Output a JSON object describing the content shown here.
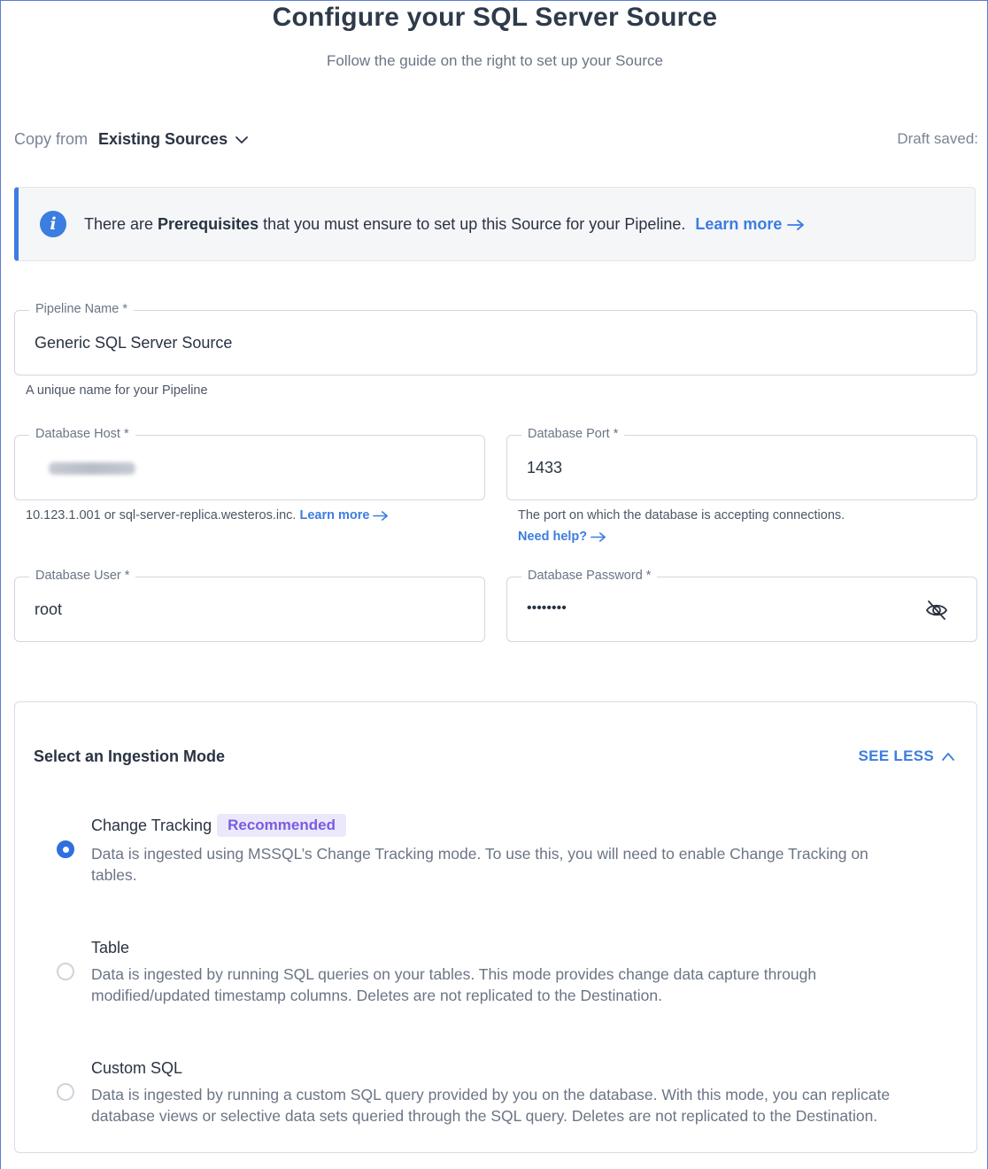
{
  "header": {
    "title": "Configure your SQL Server Source",
    "subtitle": "Follow the guide on the right to set up your Source"
  },
  "copy_from": {
    "label": "Copy from",
    "value": "Existing Sources",
    "draft_status": "Draft saved:"
  },
  "banner": {
    "text_before": "There are ",
    "bold": "Prerequisites",
    "text_after": " that you must ensure to set up this Source for your Pipeline.",
    "link": "Learn more"
  },
  "form": {
    "pipeline_name": {
      "label": "Pipeline Name *",
      "value": "Generic SQL Server Source",
      "helper": "A unique name for your Pipeline"
    },
    "db_host": {
      "label": "Database Host *",
      "helper": "10.123.1.001 or sql-server-replica.westeros.inc.",
      "helper_link": "Learn more"
    },
    "db_port": {
      "label": "Database Port *",
      "value": "1433",
      "helper": "The port on which the database is accepting connections.",
      "helper_link": "Need help?"
    },
    "db_user": {
      "label": "Database User *",
      "value": "root"
    },
    "db_password": {
      "label": "Database Password *",
      "value": "••••••••"
    }
  },
  "ingestion": {
    "title": "Select an Ingestion Mode",
    "toggle": "SEE LESS",
    "options": [
      {
        "title": "Change Tracking",
        "badge": "Recommended",
        "selected": true,
        "desc_line1": "Data is ingested using MSSQL’s Change Tracking mode. To use this, you will need to enable Change Tracking on",
        "desc_line2": "tables."
      },
      {
        "title": "Table",
        "selected": false,
        "desc_line1": "Data is ingested by running SQL queries on your tables. This mode provides change data capture through",
        "desc_line2": "modified/updated timestamp columns. Deletes are not replicated to the Destination."
      },
      {
        "title": "Custom SQL",
        "selected": false,
        "desc_line1": "Data is ingested by running a custom SQL query provided by you on the database. With this mode, you can replicate",
        "desc_line2": "database views or selective data sets queried through the SQL query. Deletes are not replicated to the Destination."
      }
    ]
  },
  "colors": {
    "accent": "#3b7de0",
    "badge_bg": "#ece8fb",
    "badge_text": "#7a5ce0"
  }
}
